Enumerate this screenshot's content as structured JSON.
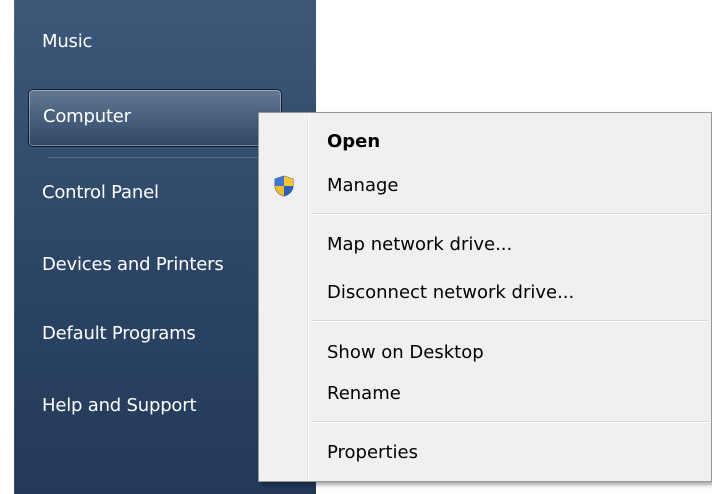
{
  "start_menu": {
    "items": [
      {
        "label": "Music"
      },
      {
        "label": "Computer"
      },
      {
        "label": "Control Panel"
      },
      {
        "label": "Devices and Printers"
      },
      {
        "label": "Default Programs"
      },
      {
        "label": "Help and Support"
      }
    ]
  },
  "context_menu": {
    "items": [
      {
        "label": "Open",
        "bold": true
      },
      {
        "label": "Manage",
        "icon": "uac-shield-icon"
      },
      {
        "label": "Map network drive..."
      },
      {
        "label": "Disconnect network drive..."
      },
      {
        "label": "Show on Desktop"
      },
      {
        "label": "Rename"
      },
      {
        "label": "Properties"
      }
    ]
  },
  "colors": {
    "start_pane": "#2c4565",
    "menu_background": "#f0f0f0",
    "menu_border": "#979797"
  }
}
